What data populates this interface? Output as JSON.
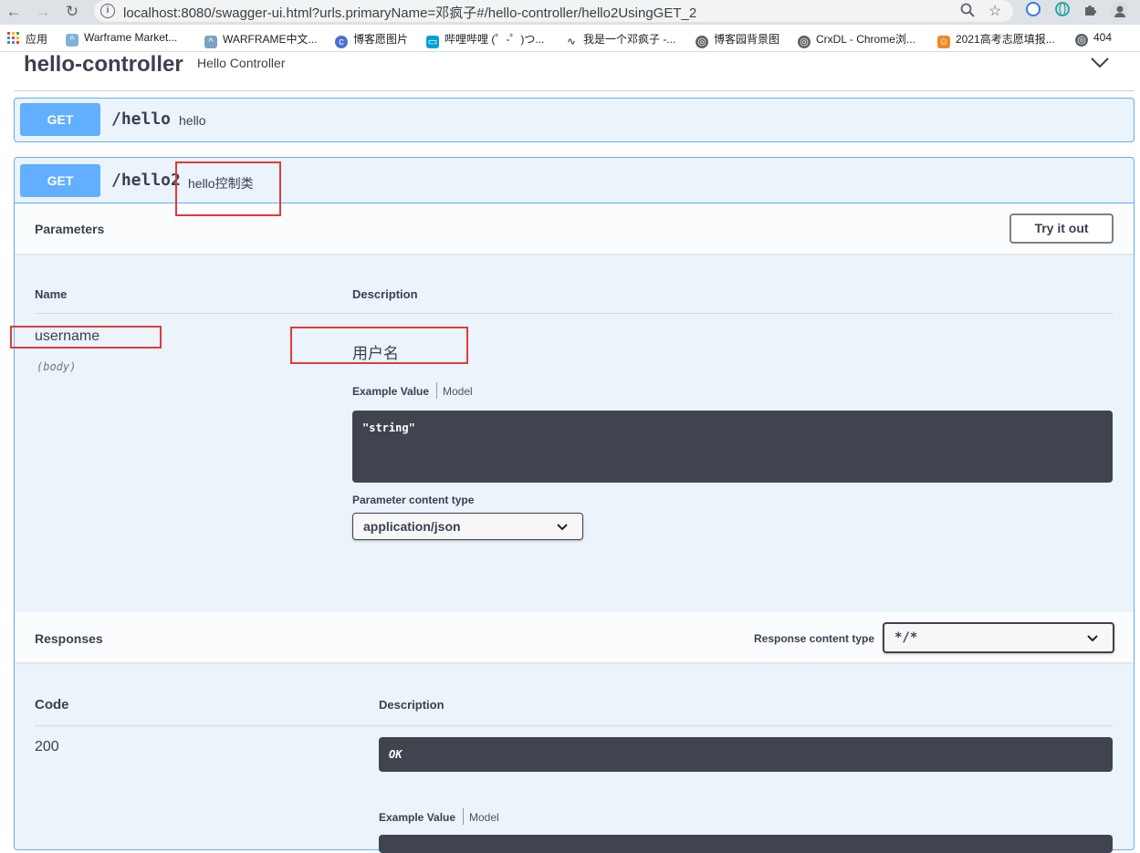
{
  "browser": {
    "url": "localhost:8080/swagger-ui.html?urls.primaryName=邓疯子#/hello-controller/hello2UsingGET_2",
    "bookmarks": [
      {
        "label": "应用",
        "color": "#ea4335"
      },
      {
        "label": "Warframe Market...",
        "color": "#7fb2d6"
      },
      {
        "label": "WARFRAME中文...",
        "color": "#7aa3c3"
      },
      {
        "label": "博客愿图片",
        "color": "#4a6fd1"
      },
      {
        "label": "哔哩哔哩 (゜-゜)つ...",
        "color": "#00a1d6"
      },
      {
        "label": "我是一个邓疯子 -...",
        "color": "#555555"
      },
      {
        "label": "博客园背景图",
        "color": "#5f6368"
      },
      {
        "label": "CrxDL - Chrome浏...",
        "color": "#5f6368"
      },
      {
        "label": "2021高考志愿填报...",
        "color": "#f08a24"
      },
      {
        "label": "404",
        "color": "#5f6368"
      }
    ]
  },
  "controller": {
    "title": "hello-controller",
    "description": "Hello Controller"
  },
  "operations": [
    {
      "method": "GET",
      "path": "/hello",
      "summary": "hello"
    },
    {
      "method": "GET",
      "path": "/hello2",
      "summary": "hello控制类"
    }
  ],
  "parameters": {
    "heading": "Parameters",
    "try_label": "Try it out",
    "col_name": "Name",
    "col_description": "Description",
    "param_name": "username",
    "param_in": "(body)",
    "param_description": "用户名",
    "example_tab": "Example Value",
    "model_tab": "Model",
    "example_value": "\"string\"",
    "content_type_label": "Parameter content type",
    "content_type_value": "application/json"
  },
  "responses": {
    "heading": "Responses",
    "content_type_label": "Response content type",
    "content_type_value": "*/*",
    "col_code": "Code",
    "col_description": "Description",
    "code": "200",
    "code_description": "OK",
    "example_tab": "Example Value",
    "model_tab": "Model"
  },
  "colors": {
    "get": "#61affe",
    "highlight": "#e03b3b",
    "code_bg": "#41444e"
  }
}
